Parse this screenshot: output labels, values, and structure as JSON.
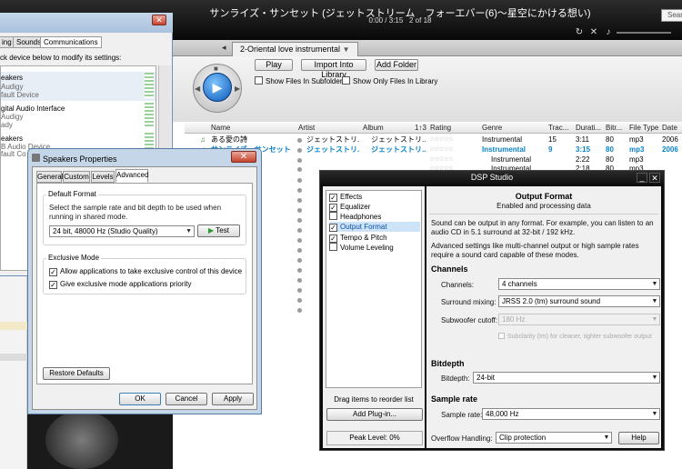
{
  "player": {
    "title": "サンライズ・サンセット (ジェットストリーム　フォーエバー(6)～星空にかける想い)",
    "time": "0:00 / 3:15",
    "position": "2 of 18",
    "search_placeholder": "Search",
    "tab_label": "2-Oriental love instrumental",
    "play_label": "Play",
    "import_label": "Import Into Library",
    "add_folder_label": "Add Folder",
    "show_subfolders": "Show Files In Subfolders",
    "show_library_only": "Show Only Files In Library",
    "columns": [
      "Name",
      "Artist",
      "Album",
      "Rating",
      "Genre",
      "Trac...",
      "Durati...",
      "Bitr...",
      "File Type",
      "Date"
    ],
    "album_sort": "1↑3",
    "tracks": [
      {
        "name": "ある愛の詩",
        "artist": "ジェットストリ...",
        "album": "ジェットストリ...",
        "genre": "Instrumental",
        "track": "15",
        "duration": "3:11",
        "bitrate": "80",
        "type": "mp3",
        "date": "2006"
      },
      {
        "name": "サンライズ・サンセット",
        "artist": "ジェットストリ...",
        "album": "ジェットストリ...",
        "genre": "Instrumental",
        "track": "9",
        "duration": "3:15",
        "bitrate": "80",
        "type": "mp3",
        "date": "2006"
      },
      {
        "genre": "Instrumental",
        "duration": "2:22",
        "bitrate": "80",
        "type": "mp3"
      },
      {
        "genre": "Instrumental",
        "duration": "2:18",
        "bitrate": "80",
        "type": "mp3"
      }
    ]
  },
  "sound_dialog": {
    "tabs": [
      "ing",
      "Sounds",
      "Communications"
    ],
    "instruction": "ck device below to modify its settings:",
    "devices": [
      {
        "name": "eakers",
        "sub1": "Audigy",
        "sub2": "fault Device"
      },
      {
        "name": "gital Audio Interface",
        "sub1": "Audigy",
        "sub2": "ady"
      },
      {
        "name": "eakers",
        "sub1": "B Audio Device",
        "sub2": "fault Con"
      }
    ]
  },
  "speakers": {
    "title": "Speakers Properties",
    "tabs": [
      "General",
      "Custom",
      "Levels",
      "Advanced"
    ],
    "default_format_title": "Default Format",
    "default_format_desc": "Select the sample rate and bit depth to be used when running in shared mode.",
    "format_value": "24 bit, 48000 Hz (Studio Quality)",
    "test_label": "Test",
    "exclusive_title": "Exclusive Mode",
    "allow_exclusive": "Allow applications to take exclusive control of this device",
    "give_priority": "Give exclusive mode applications priority",
    "restore_label": "Restore Defaults",
    "ok_label": "OK",
    "cancel_label": "Cancel",
    "apply_label": "Apply"
  },
  "dsp": {
    "title": "DSP Studio",
    "effects": [
      {
        "label": "Effects",
        "checked": true
      },
      {
        "label": "Equalizer",
        "checked": true
      },
      {
        "label": "Headphones",
        "checked": false
      },
      {
        "label": "Output Format",
        "checked": true
      },
      {
        "label": "Tempo & Pitch",
        "checked": true
      },
      {
        "label": "Volume Leveling",
        "checked": false
      }
    ],
    "drag_hint": "Drag items to reorder list",
    "add_plugin": "Add Plug-in...",
    "peak_level": "Peak Level: 0%",
    "heading": "Output Format",
    "subheading": "Enabled and processing data",
    "desc1": "Sound can be output in any format.  For example, you can listen to an audio CD in 5.1 surround at 32-bit / 192 kHz.",
    "desc2": "Advanced settings like multi-channel output or high sample rates require a sound card capable of these modes.",
    "channels_section": "Channels",
    "channels_label": "Channels:",
    "channels_value": "4 channels",
    "surround_label": "Surround mixing:",
    "surround_value": "JRSS 2.0 (tm) surround sound",
    "subwoofer_label": "Subwoofer cutoff:",
    "subwoofer_value": "180 Hz",
    "subclarity": "Subclarity (tm) for cleaner, tighter subwoofer output",
    "bitdepth_section": "Bitdepth",
    "bitdepth_label": "Bitdepth:",
    "bitdepth_value": "24-bit",
    "samplerate_section": "Sample rate",
    "samplerate_label": "Sample rate:",
    "samplerate_value": "48,000 Hz",
    "overflow_label": "Overflow Handling:",
    "overflow_value": "Clip protection",
    "help_label": "Help"
  },
  "icons": {
    "close": "✕",
    "check": "✓",
    "dropdown": "▼",
    "play": "▶"
  }
}
